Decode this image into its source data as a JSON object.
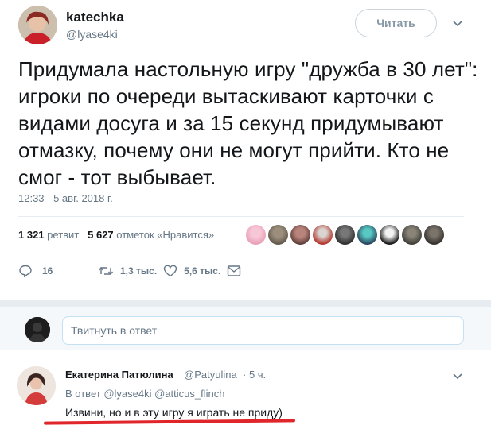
{
  "tweet": {
    "author_name": "katechka",
    "author_handle": "@lyase4ki",
    "follow_label": "Читать",
    "text": "Придумала настольную игру \"дружба в 30 лет\": игроки по очереди вытаскивают карточки с видами досуга и за 15 секунд придумывают отмазку, почему они не могут прийти. Кто не смог - тот выбывает.",
    "timestamp": "12:33 - 5 авг. 2018 г."
  },
  "stats": {
    "retweets_count": "1 321",
    "retweets_label": "ретвит",
    "likes_count": "5 627",
    "likes_label": "отметок «Нравится»"
  },
  "actions": {
    "reply_count": "16",
    "retweet_count": "1,3 тыс.",
    "like_count": "5,6 тыс."
  },
  "reply_box": {
    "placeholder": "Твитнуть в ответ"
  },
  "reply": {
    "author_name": "Екатерина Патюлина",
    "author_handle": "@Patyulina",
    "time": "· 5 ч.",
    "reply_to_prefix": "В ответ",
    "mention_1": "@lyase4ki",
    "mention_2": "@atticus_flinch",
    "text": "Извини, но и в эту игру я играть не приду)"
  },
  "colors": {
    "accent_red": "#e0262b",
    "muted": "#657786",
    "divider": "#e6ecf0"
  },
  "icons": [
    "caret-down-icon",
    "reply-icon",
    "retweet-icon",
    "heart-icon",
    "dm-icon"
  ]
}
